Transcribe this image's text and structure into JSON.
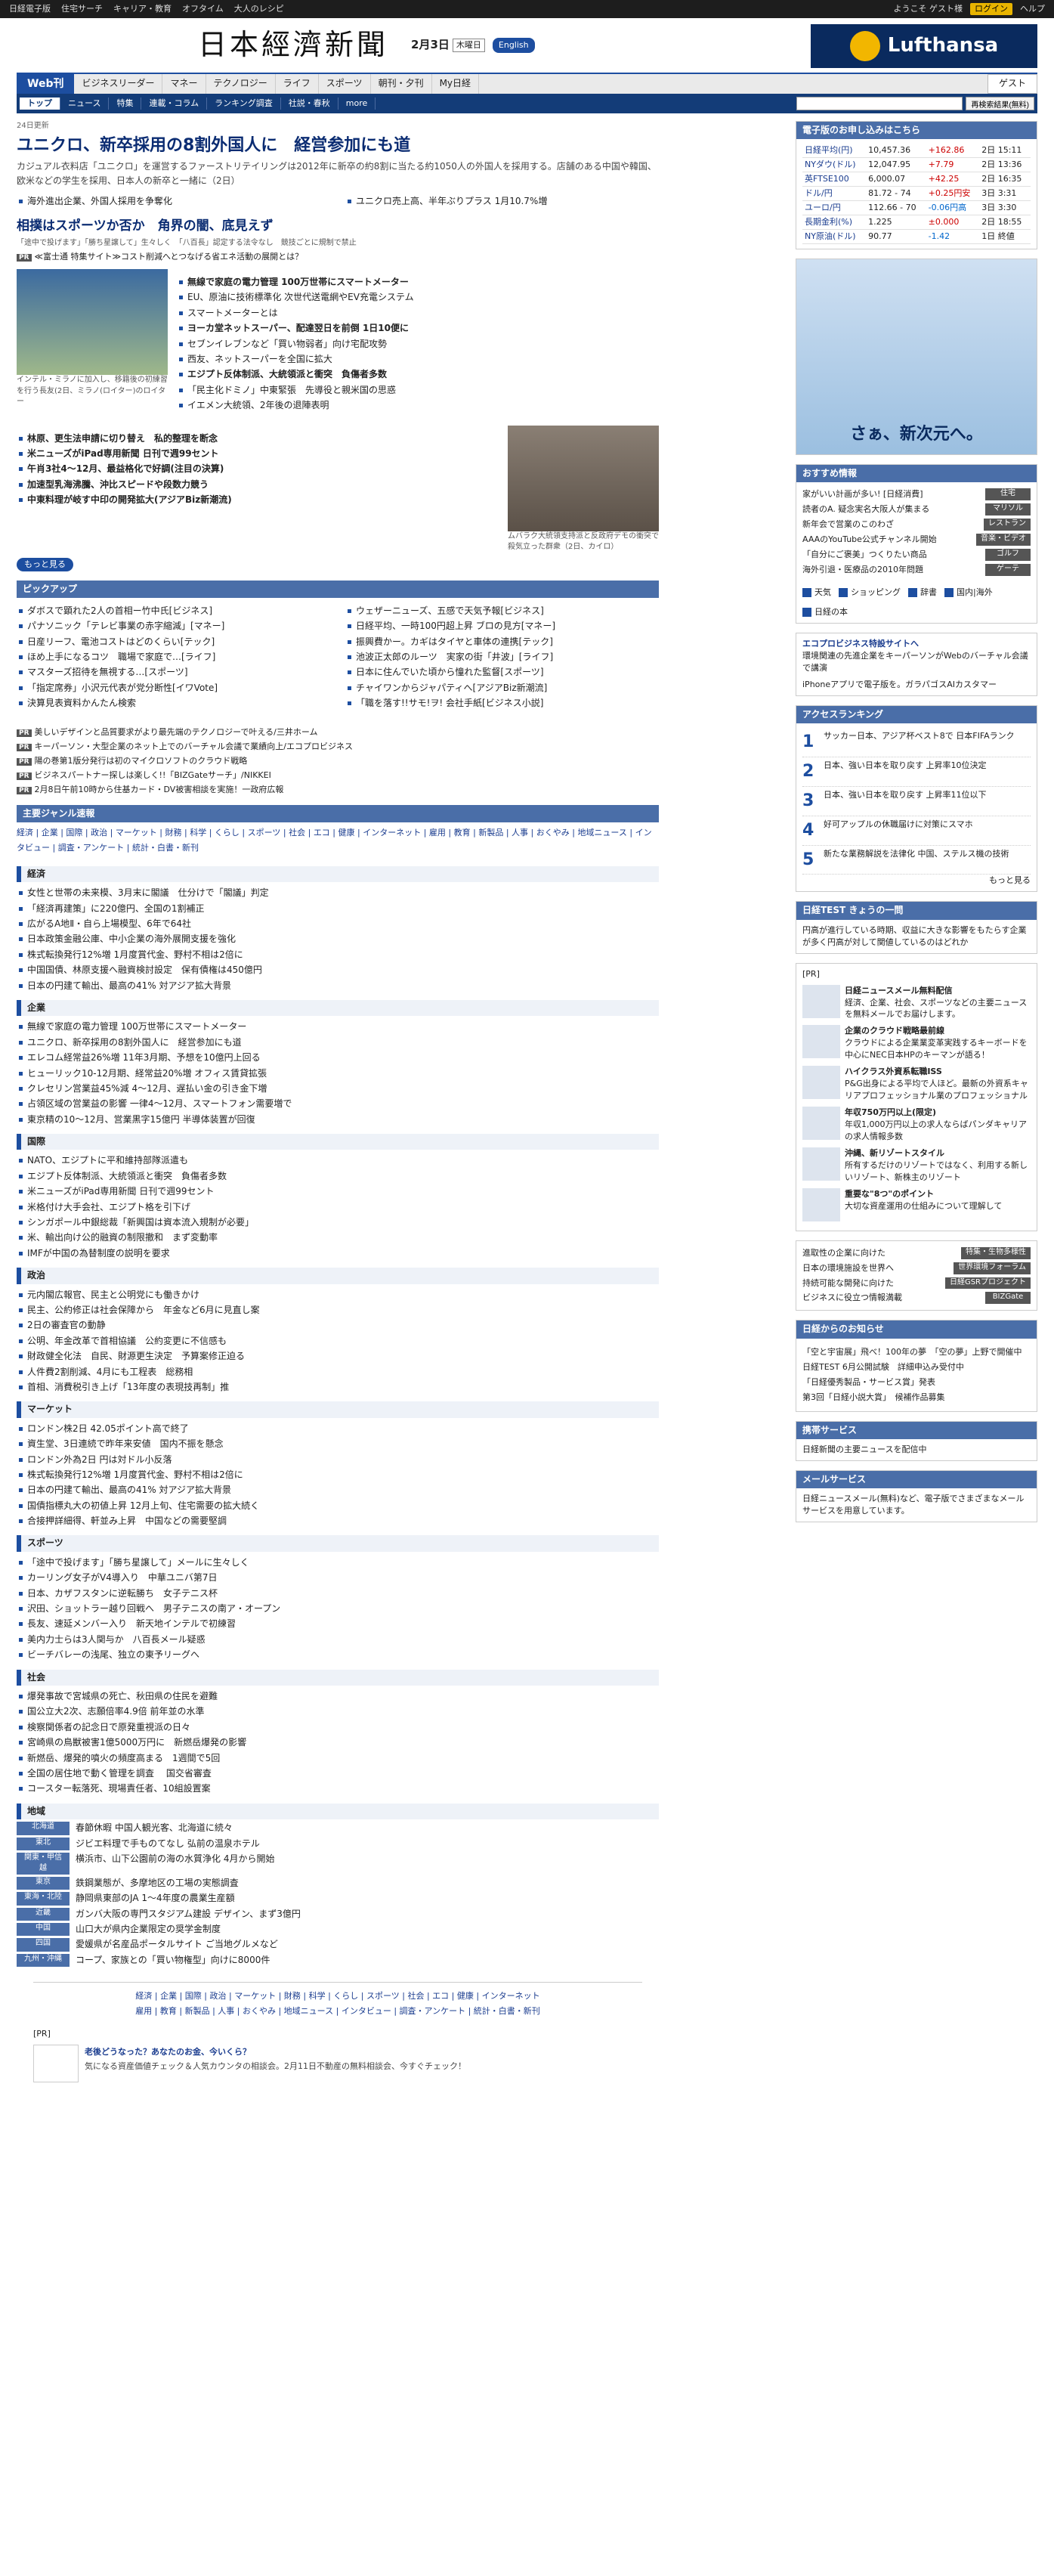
{
  "util": {
    "items": [
      "日経電子版",
      "住宅サーチ",
      "キャリア・教育",
      "オフタイム",
      "大人のレシピ"
    ],
    "welcome": "ようこそ ゲスト様",
    "login": "ログイン",
    "help": "ヘルプ"
  },
  "masthead": {
    "logo": "日本經濟新聞",
    "date": "2月3日",
    "dow": "木曜日",
    "english": "English",
    "ad": "Lufthansa"
  },
  "nav": {
    "webk": "Web刊",
    "items": [
      "ビジネスリーダー",
      "マネー",
      "テクノロジー",
      "ライフ",
      "スポーツ",
      "朝刊・夕刊",
      "My日経"
    ],
    "guest": "ゲスト"
  },
  "subnav": {
    "items": [
      "トップ",
      "ニュース",
      "特集",
      "連載・コラム",
      "ランキング調査",
      "社説・春秋",
      "more"
    ],
    "search_placeholder": "",
    "search_button": "再検索結果(無料)"
  },
  "lead": {
    "updated": "24日更新",
    "headline": "ユニクロ、新卒採用の8割外国人に　経営参加にも道",
    "summary": "カジュアル衣料店「ユニクロ」を運営するファーストリテイリングは2012年に新卒の約8割に当たる約1050人の外国人を採用する。店舗のある中国や韓国、欧米などの学生を採用、日本人の新卒と一緒に（2日）",
    "bullets": [
      "海外進出企業、外国人採用を争奪化",
      "ユニクロ売上高、半年ぶりプラス 1月10.7%増"
    ],
    "h2": "相撲はスポーツか否か　角界の闇、底見えず",
    "h2_sub": "「途中で投げます」「勝ち星譲して」生々しく　「八百長」認定する法令なし　競技ごとに規制で禁止"
  },
  "pr_top": "≪富士通 特集サイト≫コスト削減へとつなげる省エネ活動の展開とは？",
  "feature": {
    "caption": "インテル・ミラノに加入し、移籍後の初練習を行う長友(2日、ミラノ(ロイター)のロイター",
    "items": [
      "無線で家庭の電力管理 100万世帯にスマートメーター",
      "EU、原油に技術標準化 次世代送電網やEV充電システム",
      "スマートメーターとは",
      "ヨーカ堂ネットスーパー、配達翌日を前倒 1日10便に",
      "セブンイレブンなど「買い物弱者」向け宅配攻勢",
      "西友、ネットスーパーを全国に拡大",
      "エジプト反体制派、大統領派と衝突　負傷者多数",
      "「民主化ドミノ」中東緊張　先導役と親米国の思惑",
      "イエメン大統領、2年後の退陣表明"
    ]
  },
  "midnews": [
    "林原、更生法申請に切り替え　私的整理を断念",
    "米ニューズがiPad専用新聞 日刊で週99セント",
    "午肖3社4～12月、最益格化で好調(注目の決算)",
    "加速型乳海沸騰、沖比スピードや段数力競う",
    "中東料理が岐す中印の開発拡大(アジアBiz新潮流)"
  ],
  "mid_caption": "ムバラク大統領支持派と反政府デモの衝突で殺気立った群衆（2日、カイロ）",
  "more_label": "もっと見る",
  "pickup": {
    "title": "ピックアップ",
    "left": [
      "ダボスで顕れた2人の首相ー竹中氏[ビジネス]",
      "パナソニック「テレビ事業の赤字縮減」[マネー]",
      "日産リーフ、電池コストはどのくらい[テック]",
      "ほめ上手になるコツ　職場で家庭で…[ライフ]",
      "マスターズ招待を無視する…[スポーツ]",
      "「指定席券」小沢元代表が党分断性[イワVote]",
      "決算見表資料かんたん検索"
    ],
    "right": [
      "ウェザーニューズ、五感で天気予報[ビジネス]",
      "日経平均、一時100円超上昇 ブロの見方[マネー]",
      "振興費かー。カギはタイヤと車体の連携[テック]",
      "池波正太郎のルーツ　実家の街「井波」[ライフ]",
      "日本に住んでいた頃から憧れた監督[スポーツ]",
      "チャイワンからジャパティへ[アジアBiz新潮流]",
      "「職を落す!!サモ!ヲ! 会社手紙[ビジネス小説]"
    ]
  },
  "genre": {
    "title": "主要ジャンル速報",
    "links": [
      "経済",
      "企業",
      "国際",
      "政治",
      "マーケット",
      "財務",
      "科学",
      "くらし",
      "スポーツ",
      "社会",
      "エコ",
      "健康",
      "インターネット",
      "雇用",
      "教育",
      "新製品",
      "人事",
      "おくやみ",
      "地域ニュース",
      "インタビュー",
      "調査・アンケート",
      "統計・白書・新刊"
    ],
    "sections": [
      {
        "title": "経済",
        "items": [
          "女性と世帯の未来模、3月末に閣議　仕分けで「閣議」判定",
          "「経済再建策」に220億円、全国の1割補正",
          "広がるA地Ⅱ・自ら上場模型、6年で64社",
          "日本政策金融公庫、中小企業の海外展開支援を強化",
          "株式転換発行12%増 1月度賞代金、野村不相は2倍に",
          "中国国債、林原支援へ融資検討設定　保有債権は450億円",
          "日本の円建て輸出、最高の41% 対アジア拡大背景"
        ]
      },
      {
        "title": "企業",
        "items": [
          "無線で家庭の電力管理 100万世帯にスマートメーター",
          "ユニクロ、新卒採用の8割外国人に　経営参加にも道",
          "エレコム経常益26%増 11年3月期、予想を10億円上回る",
          "ヒューリック10-12月期、経常益20%増 オフィス賃貸拡張",
          "クレセリン営業益45%減 4～12月、遅払い金の引き金下増",
          "占領区域の営業益の影響 一律4～12月、スマートフォン需要増で",
          "東京精の10～12月、営業黒字15億円 半導体装置が回復"
        ]
      },
      {
        "title": "国際",
        "items": [
          "NATO、エジプトに平和維持部隊派遣も",
          "エジプト反体制派、大統領派と衝突　負傷者多数",
          "米ニューズがiPad専用新聞 日刊で週99セント",
          "米格付け大手会社、エジプト格を引下げ",
          "シンガポール中銀総裁「新興国は資本流入規制が必要」",
          "米、輸出向け公的融資の制限撤和　まず変動率",
          "IMFが中国の為替制度の説明を要求"
        ]
      },
      {
        "title": "政治",
        "items": [
          "元内閣広報官、民主と公明党にも働きかけ",
          "民主、公約修正は社会保障から　年金など6月に見直し案",
          "2日の審査官の動静",
          "公明、年金改革で首相協議　公約変更に不信感も",
          "財政健全化法　自民、財源更生決定　予算案修正迫る",
          "人件費2割削減、4月にも工程表　総務相",
          "首相、消費税引き上げ「13年度の表現技再制」推"
        ]
      },
      {
        "title": "マーケット",
        "items": [
          "ロンドン株2日 42.05ポイント高で終了",
          "資生堂、3日連続で昨年来安値　国内不振を懸念",
          "ロンドン外為2日 円は対ドル小反落",
          "株式転換発行12%増 1月度賞代金、野村不相は2倍に",
          "日本の円建て輸出、最高の41% 対アジア拡大背景",
          "国債指標丸大の初値上昇 12月上旬、住宅需要の拡大続く",
          "合接押詳細得、軒並み上昇　中国などの需要堅調"
        ]
      },
      {
        "title": "スポーツ",
        "items": [
          "「途中で投げます」「勝ち星譲して」メールに生々しく",
          "カーリング女子がV4導入り　中華ユニバ第7日",
          "日本、カザフスタンに逆転勝ち　女子テニス杯",
          "沢田、ショットラー越り回戦へ　男子テニスの南ア・オープン",
          "長友、速延メンバー入り　新天地インテルで初練習",
          "美内力士らは3人関与か　八百長メール疑惑",
          "ビーチバレーの浅尾、独立の東予リーグへ"
        ]
      },
      {
        "title": "社会",
        "items": [
          "爆発事故で宮城県の死亡、秋田県の住民を避難",
          "国公立大2次、志願倍率4.9倍 前年並の水準",
          "検察関係者の記念日で原発重視派の日々",
          "宮崎県の鳥獣被害1億5000万円に　新燃岳爆発の影響",
          "新燃岳、爆発的噴火の頻度高まる　1週間で5回",
          "全国の居住地で動く管理を調査 　国交省審査",
          "コースター転落死、現場責任者、10組設置案"
        ]
      },
      {
        "title": "地域",
        "region_items": [
          {
            "region": "北海道",
            "text": "春節休暇 中国人観光客、北海道に続々"
          },
          {
            "region": "東北",
            "text": "ジビエ料理で手ものてなし 弘前の温泉ホテル"
          },
          {
            "region": "関東・甲信越",
            "text": "横浜市、山下公園前の海の水質浄化 4月から開始"
          },
          {
            "region": "東京",
            "text": "鉄鋼業態が、多摩地区の工場の実態調査"
          },
          {
            "region": "東海・北陸",
            "text": "静岡県東部のJA 1～4年度の農業生産額"
          },
          {
            "region": "近畿",
            "text": "ガンバ大阪の専門スタジアム建設 デザイン、まず3億円"
          },
          {
            "region": "中国",
            "text": "山口大が県内企業限定の奨学金制度"
          },
          {
            "region": "四国",
            "text": "愛媛県が名産品ポータルサイト ご当地グルメなど"
          },
          {
            "region": "九州・沖縄",
            "text": "コープ、家族との「買い物権型」向けに8000件"
          }
        ]
      }
    ]
  },
  "pr_list": [
    "美しいデザインと品質要求がより最先端のテクノロジーで叶える/三井ホーム",
    "キーパーソン・大型企業のネット上でのバーチャル会議で業績向上/エコプロビジネス",
    "陽の巻第1版分発行は初のマイクロソフトのクラウド戦略",
    "ビジネスパートナー探しは楽しく!!「BIZGateサーチ」/NIKKEI",
    "2月8日午前10時から住基カード・DV被害相談を実施！一政府広報"
  ],
  "side": {
    "market_title": "電子版のお申し込みはこちら",
    "market_rows": [
      [
        "日経平均(円)",
        "10,457.36",
        "+162.86",
        "2日 15:11"
      ],
      [
        "NYダウ(ドル)",
        "12,047.95",
        "+7.79",
        "2日 13:36"
      ],
      [
        "英FTSE100",
        "6,000.07",
        "+42.25",
        "2日 16:35"
      ],
      [
        "ドル/円",
        "81.72 - 74",
        "+0.25円安",
        "3日 3:31"
      ],
      [
        "ユーロ/円",
        "112.66 - 70",
        "-0.06円高",
        "3日 3:30"
      ],
      [
        "長期金利(%)",
        "1.225",
        "±0.000",
        "2日 18:55"
      ],
      [
        "NY原油(ドル)",
        "90.77",
        "-1.42",
        "1日 終値"
      ]
    ],
    "ad_lufthansa": "さぁ、新次元へ。",
    "recommend_title": "おすすめ情報",
    "recommend": [
      [
        "家がいい計画が多い! [日経消費]",
        "住宅"
      ],
      [
        "読者のA. 疑念実名大阪人が集まる",
        "マリソル"
      ],
      [
        "新年会で営業のこのわざ",
        "レストラン"
      ],
      [
        "AAAのYouTube公式チャンネル開始",
        "音楽・ビデオ"
      ],
      [
        "「自分にご褒美」つくりたい商品",
        "ゴルフ"
      ],
      [
        "海外引退・医療品の2010年問題",
        "ゲーテ"
      ]
    ],
    "weather_links": [
      "天気",
      "ショッピング",
      "辞書",
      "国内|海外",
      "日経の本"
    ],
    "eco_title": "エコプロビジネス特設サイトへ",
    "eco_text": "環境関連の先進企業をキーパーソンがWebのバーチャル会議で講演",
    "iphone": "iPhoneアプリで電子版を。ガラパゴスAIカスタマー",
    "rank_title": "アクセスランキング",
    "ranking": [
      "サッカー日本、アジア杯ベスト8で 日本FIFAランク",
      "日本、強い日本を取り戻す 上昇率10位決定",
      "日本、強い日本を取り戻す 上昇率11位以下",
      "好可アップルの休職届けに対策にスマホ",
      "新たな業務解説を法律化 中国、ステルス機の技術"
    ],
    "rank_more": "もっと見る",
    "test_title": "日経TEST きょうの一問",
    "test_text": "円高が進行している時期、収益に大きな影響をもたらす企業が多く円高が対して関値しているのはどれか",
    "pr_label": "[PR]",
    "pr_items": [
      {
        "title": "日経ニュースメール無料配信",
        "text": "経済、企業、社会、スポーツなどの主要ニュースを無料メールでお届けします。"
      },
      {
        "title": "企業のクラウド戦略最前線",
        "text": "クラウドによる企業業変革実践するキーボードを中心にNEC日本HPのキーマンが語る！"
      },
      {
        "title": "ハイクラス外資系転職ISS",
        "text": "P&G出身による平均で人ほど。最新の外資系キャリアプロフェッショナル業のプロフェッショナル"
      },
      {
        "title": "年収750万円以上(限定)",
        "text": "年収1,000万円以上の求人ならばパンダキャリアの求人情報多数"
      },
      {
        "title": "沖縄、新リゾートスタイル",
        "text": "所有するだけのリゾートではなく、利用する新しいリゾート、新株主のリゾート"
      },
      {
        "title": "重要な\"8つ\"のポイント",
        "text": "大切な資産運用の仕組みについて理解して"
      }
    ],
    "link_tags": [
      [
        "進取性の企業に向けた",
        "特集・生物多様性"
      ],
      [
        "日本の環境施設を世界へ",
        "世界環境フォーラム"
      ],
      [
        "持続可能な開発に向けた",
        "日経GSRプロジェクト"
      ],
      [
        "ビジネスに役立つ情報満載",
        "BIZGate"
      ]
    ],
    "notice_title": "日経からのお知らせ",
    "notices": [
      "「空と宇宙展」飛べ！100年の夢　「空の夢」上野で開催中",
      "日経TEST 6月公開試験　詳細申込み受付中",
      "「日経優秀製品・サービス賞」発表",
      "第3回「日経小説大賞」　候補作品募集"
    ],
    "mobile_title": "携帯サービス",
    "mobile_text": "日経新聞の主要ニュースを配信中",
    "mail_title": "メールサービス",
    "mail_text": "日経ニュースメール(無料)など、電子版でさまざまなメールサービスを用意しています。"
  },
  "footer": {
    "lines": [
      "経済 | 企業 | 国際 | 政治 | マーケット | 財務 | 科学 | くらし | スポーツ | 社会 | エコ | 健康 | インターネット",
      "雇用 | 教育 | 新製品 | 人事 | おくやみ | 地域ニュース | インタビュー | 調査・アンケート | 統計・白書・新刊"
    ],
    "pr": "[PR]",
    "pr_title": "老後どうなった？あなたのお金、今いくら？",
    "pr_text": "気になる資産価値チェック＆人気カウンタの相談会。2月11日不動産の無料相談会、今すぐチェック！"
  }
}
